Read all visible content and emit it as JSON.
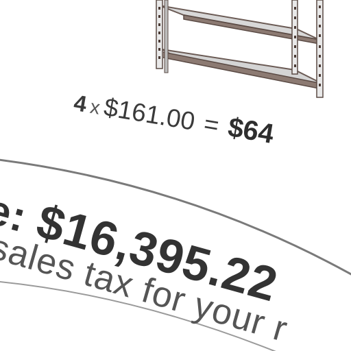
{
  "cart_item": {
    "image_icon": "metal-shelving-unit",
    "quantity": "4",
    "times_symbol": "x",
    "unit_price": "$161.00",
    "equals_symbol": "=",
    "line_total": "$64"
  },
  "order_total": {
    "label_tail": "e:",
    "amount": "$16,395.22",
    "tax_note": "sales tax for your r"
  },
  "colors": {
    "text_dark": "#333333",
    "text_muted": "#555555",
    "panel_border": "#7a7a7a",
    "shelf_frame": "#5a4a44",
    "shelf_board": "#d6d6d6"
  }
}
